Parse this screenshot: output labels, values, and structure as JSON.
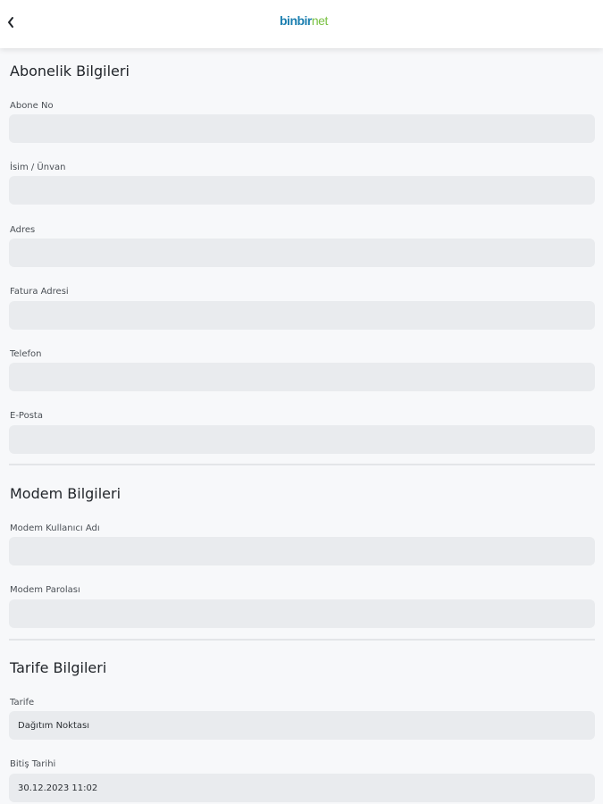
{
  "header": {
    "back_glyph": "‹",
    "logo_part1": "binbir",
    "logo_part2": "net"
  },
  "sections": {
    "subscription": {
      "title": "Abonelik Bilgileri",
      "fields": [
        {
          "label": "Abone No",
          "value": ""
        },
        {
          "label": "İsim / Ünvan",
          "value": ""
        },
        {
          "label": "Adres",
          "value": ""
        },
        {
          "label": "Fatura Adresi",
          "value": ""
        },
        {
          "label": "Telefon",
          "value": ""
        },
        {
          "label": "E-Posta",
          "value": ""
        }
      ]
    },
    "modem": {
      "title": "Modem Bilgileri",
      "fields": [
        {
          "label": "Modem Kullanıcı Adı",
          "value": ""
        },
        {
          "label": "Modem Parolası",
          "value": ""
        }
      ]
    },
    "tariff": {
      "title": "Tarife Bilgileri",
      "fields": [
        {
          "label": "Tarife",
          "value": "Dağıtım Noktası"
        },
        {
          "label": "Bitiş Tarihi",
          "value": "30.12.2023 11:02"
        }
      ]
    }
  },
  "colors": {
    "logo_blue": "#1c7fb0",
    "logo_green": "#79c142",
    "input_bg": "#e9ebee",
    "page_bg": "#f7f8fa"
  }
}
